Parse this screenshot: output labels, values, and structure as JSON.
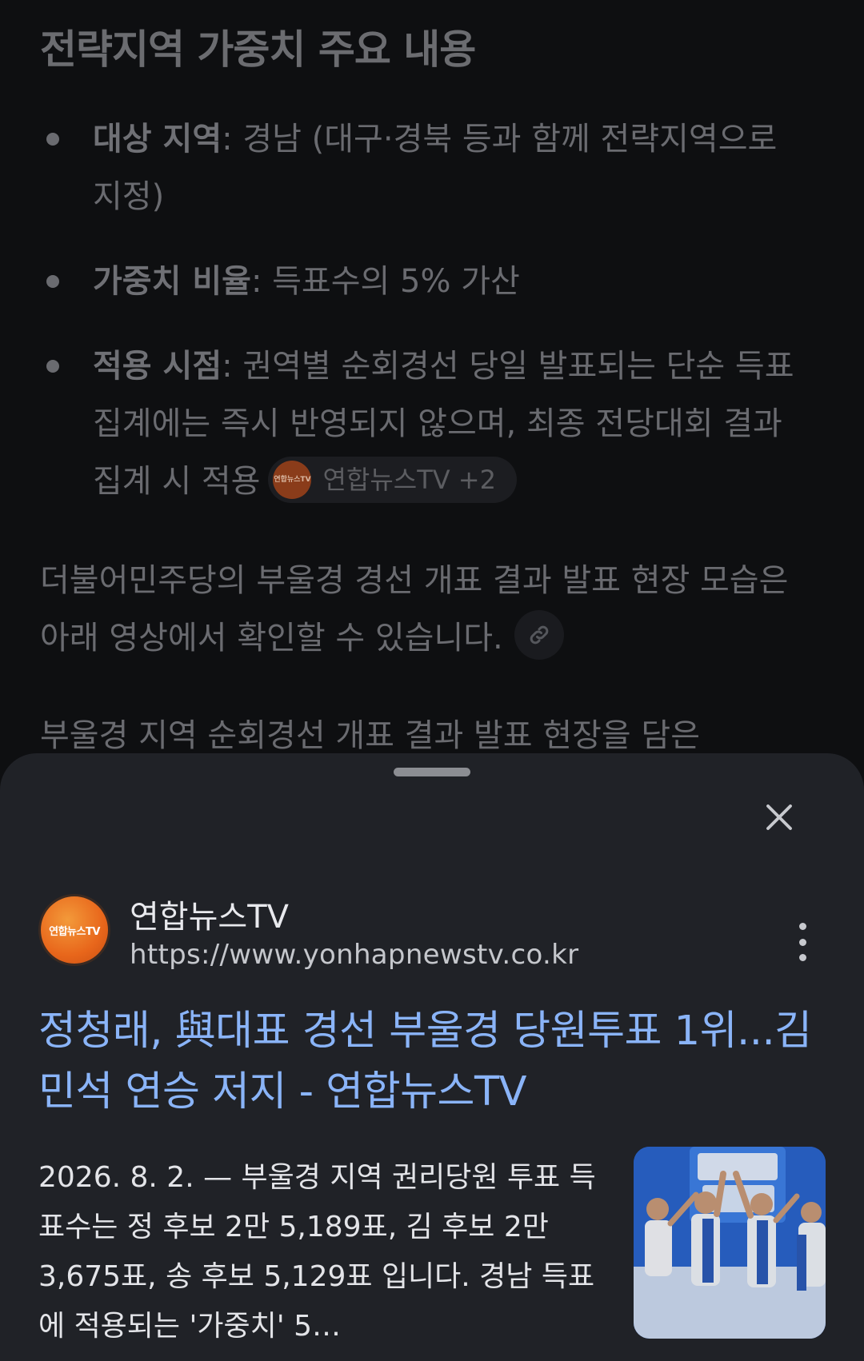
{
  "article": {
    "heading": "전략지역 가중치 주요 내용",
    "bullets": [
      {
        "label": "대상 지역",
        "text": ": 경남 (대구·경북 등과 함께 전략지역으로 지정)"
      },
      {
        "label": "가중치 비율",
        "text": ": 득표수의 5% 가산"
      },
      {
        "label": "적용 시점",
        "text": ": 권역별 순회경선 당일 발표되는 단순 득표 집계에는 즉시 반영되지 않으며, 최종 전당대회 결과 집계 시 적용"
      }
    ],
    "chip": {
      "logo_text": "연합뉴스TV",
      "label": "연합뉴스TV +2"
    },
    "para1": "더불어민주당의 부울경 경선 개표 결과 발표 현장 모습은 아래 영상에서 확인할 수 있습니다.",
    "para2": "부울경 지역 순회경선 개표 결과 발표 현장을 담은"
  },
  "sheet": {
    "source_name": "연합뉴스TV",
    "source_logo_text": "연합뉴스TV",
    "source_url": "https://www.yonhapnewstv.co.kr",
    "title": "정청래, 與대표 경선 부울경 당원투표 1위...김민석 연승 저지 - 연합뉴스TV",
    "snippet": "2026. 8. 2. — 부울경 지역 권리당원 투표 득표수는 정 후보 2만 5,189표, 김 후보 2만 3,675표, 송 후보 5,129표 입니다. 경남 득표에 적용되는 '가중치' 5…",
    "thumbnail_alt": "thumbnail"
  },
  "icons": {
    "close": "close-icon",
    "more": "more-vert-icon",
    "link": "link-icon"
  },
  "colors": {
    "background": "#0e0f11",
    "sheet": "#202227",
    "link_title": "#8ab4f8",
    "logo_orange": "#e8661b"
  }
}
